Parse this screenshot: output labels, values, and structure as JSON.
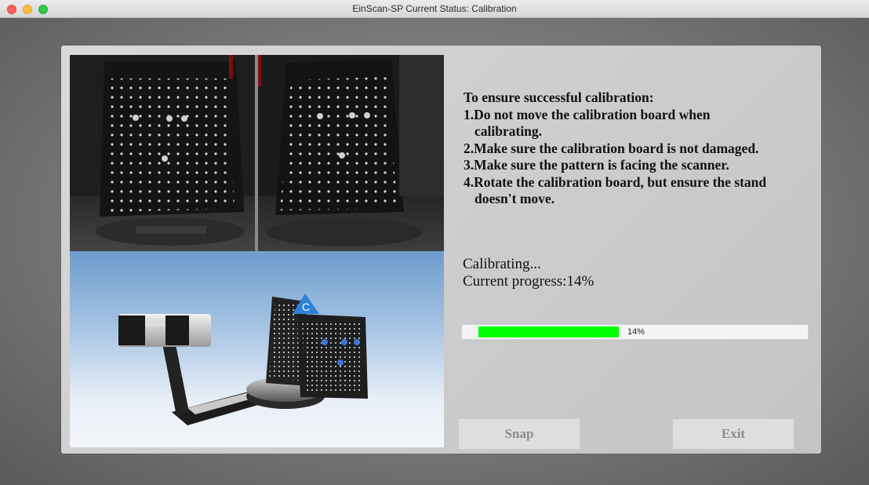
{
  "window": {
    "title": "EinScan-SP Current Status: Calibration",
    "controls": [
      "close",
      "minimize",
      "maximize"
    ]
  },
  "instructions": {
    "heading": "To ensure successful calibration:",
    "item1_line1": "1.Do not move the calibration board when",
    "item1_line2": "calibrating.",
    "item2": "2.Make sure the calibration board is not damaged.",
    "item3": "3.Make sure the pattern is facing the scanner.",
    "item4_line1": "4.Rotate the calibration board, but ensure the stand",
    "item4_line2": "doesn't move."
  },
  "status": {
    "state": "Calibrating...",
    "progress_text": "Current progress:14%"
  },
  "progress": {
    "value": 0.14,
    "label": "14%",
    "fill_color": "#00ff00"
  },
  "buttons": {
    "snap": "Snap",
    "exit": "Exit"
  },
  "preview": {
    "badge_letter": "C",
    "accent_color": "#2f80d8"
  }
}
